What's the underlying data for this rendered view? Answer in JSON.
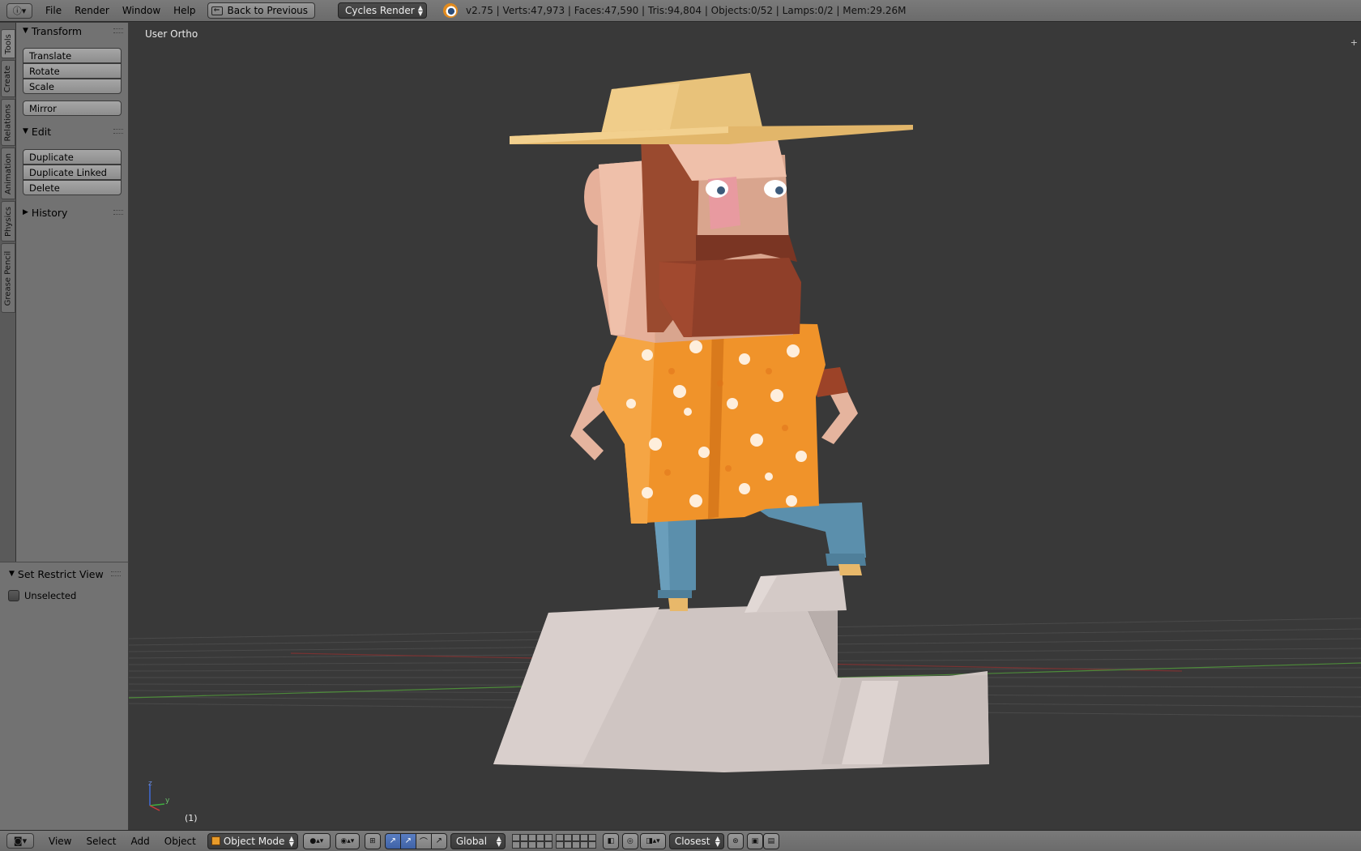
{
  "topbar": {
    "editor_icon": "info-icon",
    "menus": [
      "File",
      "Render",
      "Window",
      "Help"
    ],
    "back_button": "Back to Previous",
    "render_engine": "Cycles Render",
    "stats": "v2.75 | Verts:47,973 | Faces:47,590 | Tris:94,804 | Objects:0/52 | Lamps:0/2 | Mem:29.26M"
  },
  "tabs": [
    "Tools",
    "Create",
    "Relations",
    "Animation",
    "Physics",
    "Grease Pencil"
  ],
  "toolshelf": {
    "transform_title": "Transform",
    "transform_buttons": [
      "Translate",
      "Rotate",
      "Scale"
    ],
    "mirror": "Mirror",
    "edit_title": "Edit",
    "edit_buttons": [
      "Duplicate",
      "Duplicate Linked",
      "Delete"
    ],
    "history_title": "History"
  },
  "operator": {
    "title": "Set Restrict View",
    "checkbox_label": "Unselected"
  },
  "viewport": {
    "view_label": "User Ortho",
    "frame_label": "(1)",
    "axis_z": "z",
    "axis_y": "y",
    "grid_color": "#4a4a4a",
    "axis_x_color": "#8a3a3a",
    "axis_y_color": "#4d8a3a"
  },
  "bottombar": {
    "menus": [
      "View",
      "Select",
      "Add",
      "Object"
    ],
    "mode": "Object Mode",
    "orientation": "Global",
    "snap": "Closest"
  }
}
